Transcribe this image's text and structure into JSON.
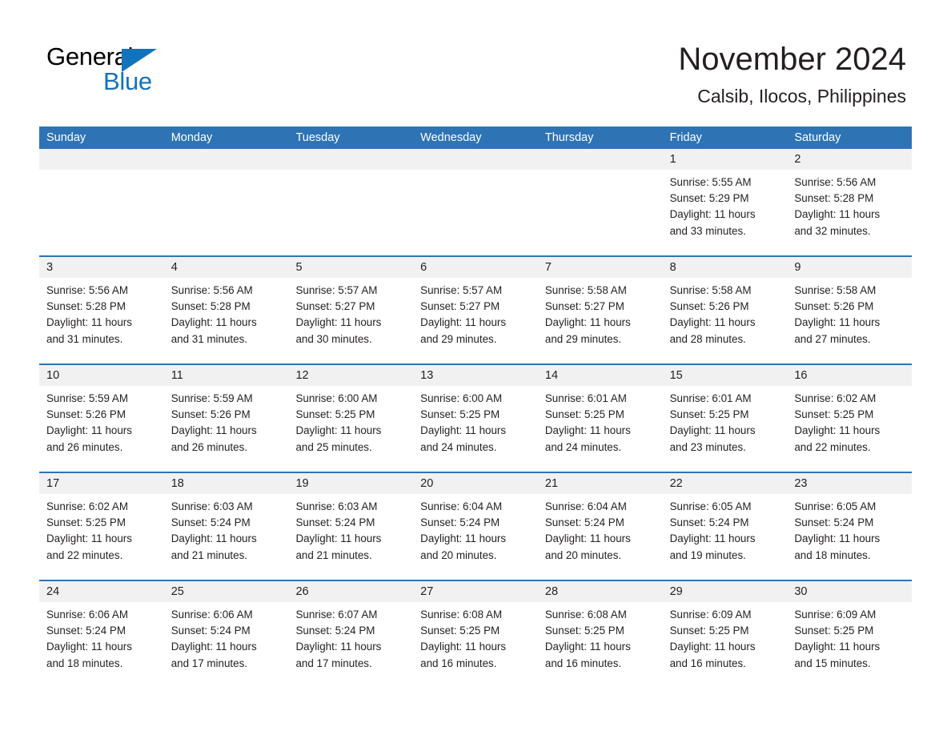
{
  "brand": {
    "logo_text_1": "General",
    "logo_text_2": "Blue",
    "logo_color": "#1273bc"
  },
  "header": {
    "month_title": "November 2024",
    "location": "Calsib, Ilocos, Philippines"
  },
  "theme": {
    "header_blue": "#2e74b5",
    "day_band_gray": "#f1f1f1",
    "text": "#231f20"
  },
  "calendar": {
    "weekdays": [
      "Sunday",
      "Monday",
      "Tuesday",
      "Wednesday",
      "Thursday",
      "Friday",
      "Saturday"
    ],
    "weeks": [
      [
        {
          "day": "",
          "empty": true
        },
        {
          "day": "",
          "empty": true
        },
        {
          "day": "",
          "empty": true
        },
        {
          "day": "",
          "empty": true
        },
        {
          "day": "",
          "empty": true
        },
        {
          "day": "1",
          "sunrise": "Sunrise: 5:55 AM",
          "sunset": "Sunset: 5:29 PM",
          "daylight_1": "Daylight: 11 hours",
          "daylight_2": "and 33 minutes."
        },
        {
          "day": "2",
          "sunrise": "Sunrise: 5:56 AM",
          "sunset": "Sunset: 5:28 PM",
          "daylight_1": "Daylight: 11 hours",
          "daylight_2": "and 32 minutes."
        }
      ],
      [
        {
          "day": "3",
          "sunrise": "Sunrise: 5:56 AM",
          "sunset": "Sunset: 5:28 PM",
          "daylight_1": "Daylight: 11 hours",
          "daylight_2": "and 31 minutes."
        },
        {
          "day": "4",
          "sunrise": "Sunrise: 5:56 AM",
          "sunset": "Sunset: 5:28 PM",
          "daylight_1": "Daylight: 11 hours",
          "daylight_2": "and 31 minutes."
        },
        {
          "day": "5",
          "sunrise": "Sunrise: 5:57 AM",
          "sunset": "Sunset: 5:27 PM",
          "daylight_1": "Daylight: 11 hours",
          "daylight_2": "and 30 minutes."
        },
        {
          "day": "6",
          "sunrise": "Sunrise: 5:57 AM",
          "sunset": "Sunset: 5:27 PM",
          "daylight_1": "Daylight: 11 hours",
          "daylight_2": "and 29 minutes."
        },
        {
          "day": "7",
          "sunrise": "Sunrise: 5:58 AM",
          "sunset": "Sunset: 5:27 PM",
          "daylight_1": "Daylight: 11 hours",
          "daylight_2": "and 29 minutes."
        },
        {
          "day": "8",
          "sunrise": "Sunrise: 5:58 AM",
          "sunset": "Sunset: 5:26 PM",
          "daylight_1": "Daylight: 11 hours",
          "daylight_2": "and 28 minutes."
        },
        {
          "day": "9",
          "sunrise": "Sunrise: 5:58 AM",
          "sunset": "Sunset: 5:26 PM",
          "daylight_1": "Daylight: 11 hours",
          "daylight_2": "and 27 minutes."
        }
      ],
      [
        {
          "day": "10",
          "sunrise": "Sunrise: 5:59 AM",
          "sunset": "Sunset: 5:26 PM",
          "daylight_1": "Daylight: 11 hours",
          "daylight_2": "and 26 minutes."
        },
        {
          "day": "11",
          "sunrise": "Sunrise: 5:59 AM",
          "sunset": "Sunset: 5:26 PM",
          "daylight_1": "Daylight: 11 hours",
          "daylight_2": "and 26 minutes."
        },
        {
          "day": "12",
          "sunrise": "Sunrise: 6:00 AM",
          "sunset": "Sunset: 5:25 PM",
          "daylight_1": "Daylight: 11 hours",
          "daylight_2": "and 25 minutes."
        },
        {
          "day": "13",
          "sunrise": "Sunrise: 6:00 AM",
          "sunset": "Sunset: 5:25 PM",
          "daylight_1": "Daylight: 11 hours",
          "daylight_2": "and 24 minutes."
        },
        {
          "day": "14",
          "sunrise": "Sunrise: 6:01 AM",
          "sunset": "Sunset: 5:25 PM",
          "daylight_1": "Daylight: 11 hours",
          "daylight_2": "and 24 minutes."
        },
        {
          "day": "15",
          "sunrise": "Sunrise: 6:01 AM",
          "sunset": "Sunset: 5:25 PM",
          "daylight_1": "Daylight: 11 hours",
          "daylight_2": "and 23 minutes."
        },
        {
          "day": "16",
          "sunrise": "Sunrise: 6:02 AM",
          "sunset": "Sunset: 5:25 PM",
          "daylight_1": "Daylight: 11 hours",
          "daylight_2": "and 22 minutes."
        }
      ],
      [
        {
          "day": "17",
          "sunrise": "Sunrise: 6:02 AM",
          "sunset": "Sunset: 5:25 PM",
          "daylight_1": "Daylight: 11 hours",
          "daylight_2": "and 22 minutes."
        },
        {
          "day": "18",
          "sunrise": "Sunrise: 6:03 AM",
          "sunset": "Sunset: 5:24 PM",
          "daylight_1": "Daylight: 11 hours",
          "daylight_2": "and 21 minutes."
        },
        {
          "day": "19",
          "sunrise": "Sunrise: 6:03 AM",
          "sunset": "Sunset: 5:24 PM",
          "daylight_1": "Daylight: 11 hours",
          "daylight_2": "and 21 minutes."
        },
        {
          "day": "20",
          "sunrise": "Sunrise: 6:04 AM",
          "sunset": "Sunset: 5:24 PM",
          "daylight_1": "Daylight: 11 hours",
          "daylight_2": "and 20 minutes."
        },
        {
          "day": "21",
          "sunrise": "Sunrise: 6:04 AM",
          "sunset": "Sunset: 5:24 PM",
          "daylight_1": "Daylight: 11 hours",
          "daylight_2": "and 20 minutes."
        },
        {
          "day": "22",
          "sunrise": "Sunrise: 6:05 AM",
          "sunset": "Sunset: 5:24 PM",
          "daylight_1": "Daylight: 11 hours",
          "daylight_2": "and 19 minutes."
        },
        {
          "day": "23",
          "sunrise": "Sunrise: 6:05 AM",
          "sunset": "Sunset: 5:24 PM",
          "daylight_1": "Daylight: 11 hours",
          "daylight_2": "and 18 minutes."
        }
      ],
      [
        {
          "day": "24",
          "sunrise": "Sunrise: 6:06 AM",
          "sunset": "Sunset: 5:24 PM",
          "daylight_1": "Daylight: 11 hours",
          "daylight_2": "and 18 minutes."
        },
        {
          "day": "25",
          "sunrise": "Sunrise: 6:06 AM",
          "sunset": "Sunset: 5:24 PM",
          "daylight_1": "Daylight: 11 hours",
          "daylight_2": "and 17 minutes."
        },
        {
          "day": "26",
          "sunrise": "Sunrise: 6:07 AM",
          "sunset": "Sunset: 5:24 PM",
          "daylight_1": "Daylight: 11 hours",
          "daylight_2": "and 17 minutes."
        },
        {
          "day": "27",
          "sunrise": "Sunrise: 6:08 AM",
          "sunset": "Sunset: 5:25 PM",
          "daylight_1": "Daylight: 11 hours",
          "daylight_2": "and 16 minutes."
        },
        {
          "day": "28",
          "sunrise": "Sunrise: 6:08 AM",
          "sunset": "Sunset: 5:25 PM",
          "daylight_1": "Daylight: 11 hours",
          "daylight_2": "and 16 minutes."
        },
        {
          "day": "29",
          "sunrise": "Sunrise: 6:09 AM",
          "sunset": "Sunset: 5:25 PM",
          "daylight_1": "Daylight: 11 hours",
          "daylight_2": "and 16 minutes."
        },
        {
          "day": "30",
          "sunrise": "Sunrise: 6:09 AM",
          "sunset": "Sunset: 5:25 PM",
          "daylight_1": "Daylight: 11 hours",
          "daylight_2": "and 15 minutes."
        }
      ]
    ]
  }
}
